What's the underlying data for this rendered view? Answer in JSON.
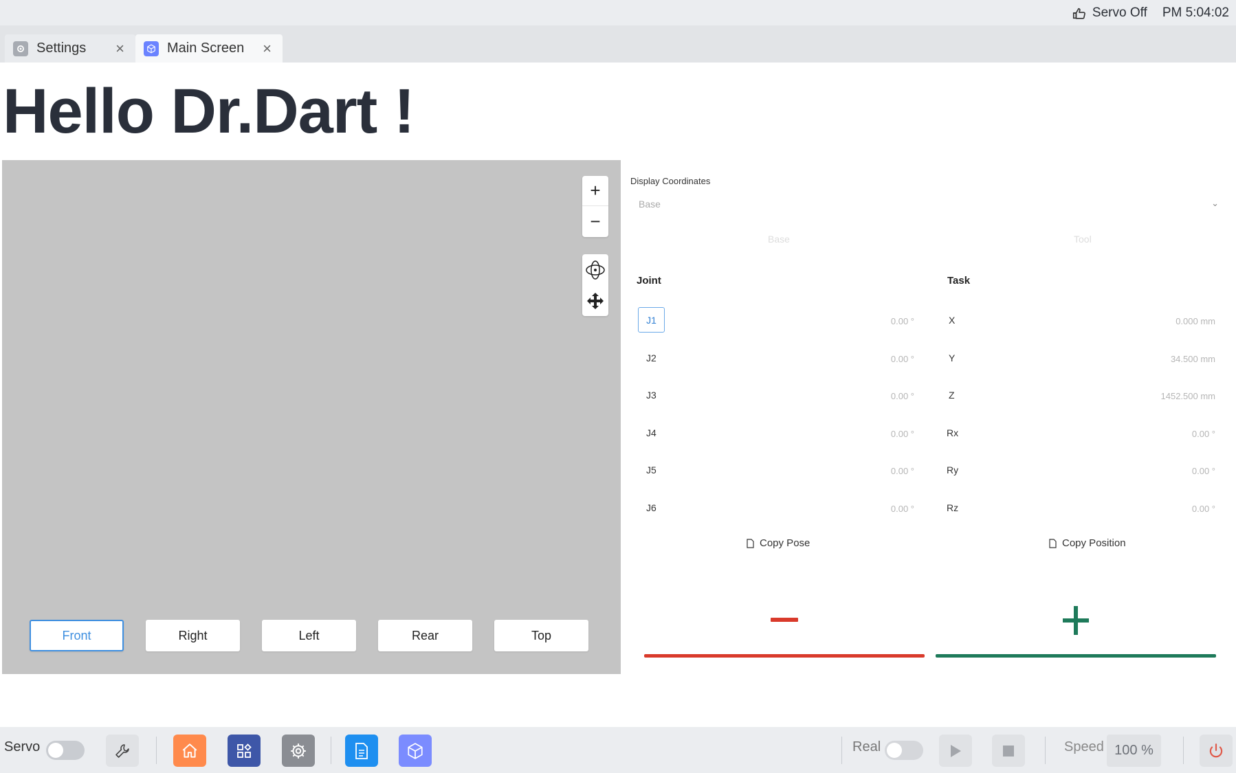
{
  "status": {
    "servo": "Servo Off",
    "time": "PM 5:04:02"
  },
  "tabs": [
    {
      "label": "Settings",
      "icon": "gear-icon"
    },
    {
      "label": "Main Screen",
      "icon": "cube-icon"
    }
  ],
  "greeting": "Hello Dr.Dart !",
  "viewport": {
    "zoom_in": "+",
    "zoom_out": "−",
    "views": [
      "Front",
      "Right",
      "Left",
      "Rear",
      "Top"
    ],
    "active_view": "Front"
  },
  "coordinates": {
    "label": "Display Coordinates",
    "selected": "Base",
    "segments": [
      "Base",
      "Tool"
    ]
  },
  "joint": {
    "title": "Joint",
    "rows": [
      {
        "label": "J1",
        "value": "0.00 °"
      },
      {
        "label": "J2",
        "value": "0.00 °"
      },
      {
        "label": "J3",
        "value": "0.00 °"
      },
      {
        "label": "J4",
        "value": "0.00 °"
      },
      {
        "label": "J5",
        "value": "0.00 °"
      },
      {
        "label": "J6",
        "value": "0.00 °"
      }
    ],
    "copy": "Copy Pose"
  },
  "task": {
    "title": "Task",
    "rows": [
      {
        "label": "X",
        "value": "0.000  mm"
      },
      {
        "label": "Y",
        "value": "34.500  mm"
      },
      {
        "label": "Z",
        "value": "1452.500  mm"
      },
      {
        "label": "Rx",
        "value": "0.00 °"
      },
      {
        "label": "Ry",
        "value": "0.00 °"
      },
      {
        "label": "Rz",
        "value": "0.00 °"
      }
    ],
    "copy": "Copy Position"
  },
  "toolbar": {
    "servo_label": "Servo",
    "real_label": "Real",
    "speed_label": "Speed",
    "speed_value": "100 %"
  },
  "colors": {
    "accent_blue": "#3f8fe0",
    "minus_red": "#d93a2b",
    "plus_green": "#1e7a5a",
    "home_orange": "#ff8a4c",
    "apps_navy": "#3e57a8",
    "settings_gray": "#8a8d93",
    "doc_blue": "#1e8ff0",
    "cube_purple": "#7b8cff",
    "power_red": "#e05a4a"
  }
}
